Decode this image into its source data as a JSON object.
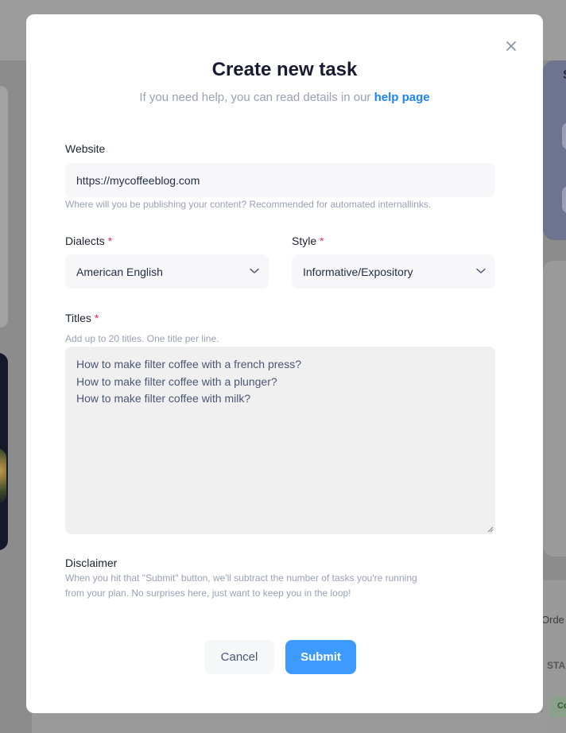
{
  "background": {
    "violet_card_title": "S",
    "table_header": "Orde",
    "status_header": "STA",
    "status_badge": "Co"
  },
  "modal": {
    "close_icon": "close-icon",
    "title": "Create new task",
    "subtitle_text": "If you need help, you can read details in our ",
    "subtitle_link": "help page"
  },
  "form": {
    "website": {
      "label": "Website",
      "value": "https://mycoffeeblog.com",
      "hint": "Where will you be publishing your content? Recommended for automated internallinks."
    },
    "dialects": {
      "label": "Dialects",
      "required_mark": "*",
      "selected": "American English"
    },
    "style": {
      "label": "Style",
      "required_mark": "*",
      "selected": "Informative/Expository"
    },
    "titles": {
      "label": "Titles",
      "required_mark": "*",
      "hint": "Add up to 20 titles. One title per line.",
      "lines": [
        "How to make filter coffee with a french press?",
        "How to make filter coffee with a plunger?",
        "How to make filter coffee with milk?"
      ]
    },
    "disclaimer": {
      "label": "Disclaimer",
      "text_line1": "When you hit that \"Submit\" button, we'll subtract the number of tasks you're running",
      "text_line2": "from your plan. No surprises here, just want to keep you in the loop!"
    }
  },
  "actions": {
    "cancel_label": "Cancel",
    "submit_label": "Submit"
  },
  "colors": {
    "accent": "#1b84ff",
    "submit_bg": "#3d9bff",
    "required": "#f8285a"
  }
}
